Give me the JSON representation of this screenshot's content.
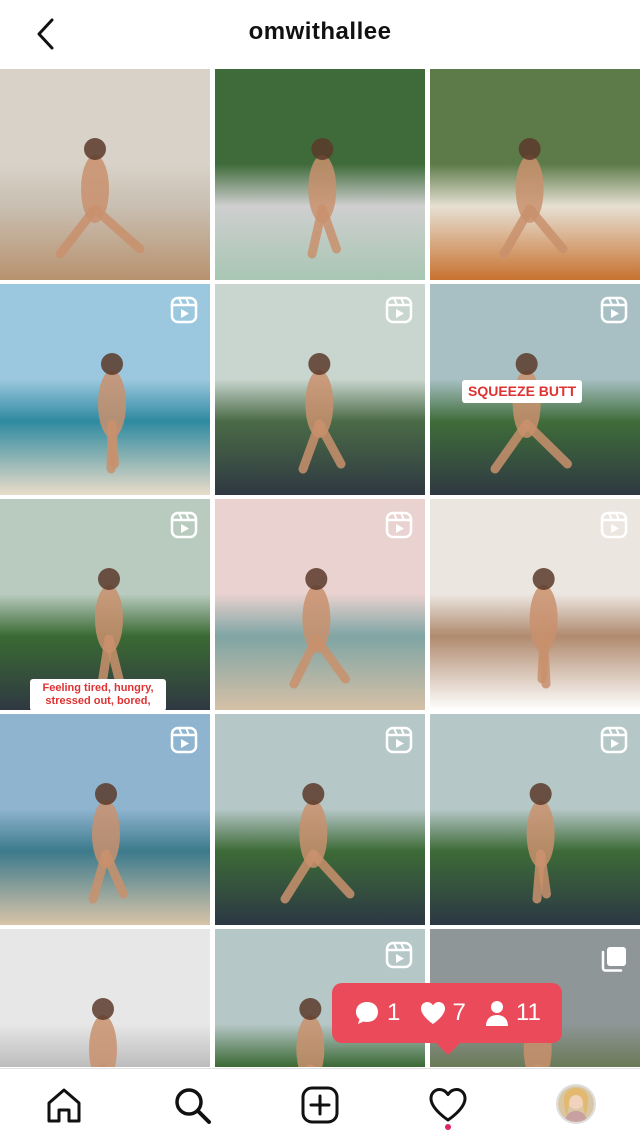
{
  "header": {
    "username": "omwithallee",
    "back_icon": "chevron-left-icon"
  },
  "grid": {
    "posts": [
      {
        "kind": "photo",
        "scene": "wall-backbend",
        "colors": [
          "#d9d2c8",
          "#c9bfb2",
          "#b8926f"
        ]
      },
      {
        "kind": "photo",
        "scene": "handstand-hedge",
        "colors": [
          "#3f6b3a",
          "#cfcfcf",
          "#a8c6b3"
        ]
      },
      {
        "kind": "photo",
        "scene": "holding-fruit",
        "colors": [
          "#5d7b49",
          "#e6e0d3",
          "#c8722f"
        ]
      },
      {
        "kind": "reel",
        "scene": "beach-pose",
        "colors": [
          "#9cc8df",
          "#2f8aa0",
          "#e9dcc9"
        ]
      },
      {
        "kind": "reel",
        "scene": "partner-yoga",
        "colors": [
          "#c9d6cf",
          "#4a6b46",
          "#2f3842"
        ]
      },
      {
        "kind": "reel",
        "scene": "palm-handstand",
        "colors": [
          "#a8c0c4",
          "#3f6d3a",
          "#2f3842"
        ],
        "overlay": "SQUEEZE BUTT"
      },
      {
        "kind": "reel",
        "scene": "garden-backbend",
        "colors": [
          "#b9cbbf",
          "#3a6a33",
          "#2f3842"
        ],
        "overlay": "Feeling tired, hungry, stressed out, bored,"
      },
      {
        "kind": "reel",
        "scene": "sunset-beach",
        "colors": [
          "#e9d2cf",
          "#7fa5a4",
          "#d6c0a6"
        ]
      },
      {
        "kind": "reel",
        "scene": "meditation-duo",
        "colors": [
          "#ece6e1",
          "#b08a6e",
          "#ffffff"
        ]
      },
      {
        "kind": "reel",
        "scene": "ocean-lunge",
        "colors": [
          "#8fb4cf",
          "#3c7a8c",
          "#d8c4a8"
        ]
      },
      {
        "kind": "reel",
        "scene": "arm-balance",
        "colors": [
          "#b6c7c7",
          "#3d6b37",
          "#2c3744"
        ]
      },
      {
        "kind": "reel",
        "scene": "crow-pose",
        "colors": [
          "#b6c7c7",
          "#3d6b37",
          "#2c3744"
        ]
      },
      {
        "kind": "photo",
        "scene": "wall-inversion",
        "colors": [
          "#e7e7e7",
          "#bdbdbd",
          "#d1b39a"
        ]
      },
      {
        "kind": "reel",
        "scene": "palm-inversion",
        "colors": [
          "#b6c7c7",
          "#3d6b37",
          "#e6e6e6"
        ]
      },
      {
        "kind": "multi",
        "scene": "waterfall",
        "colors": [
          "#8e9697",
          "#6b7a58",
          "#b7a990"
        ]
      }
    ]
  },
  "activity": {
    "comments": "1",
    "likes": "7",
    "follows": "11",
    "color": "#ea4a5a"
  },
  "nav": {
    "items": [
      "home-icon",
      "search-icon",
      "new-post-icon",
      "activity-heart-icon",
      "profile-avatar"
    ],
    "notification_dot_color": "#e0245e"
  }
}
